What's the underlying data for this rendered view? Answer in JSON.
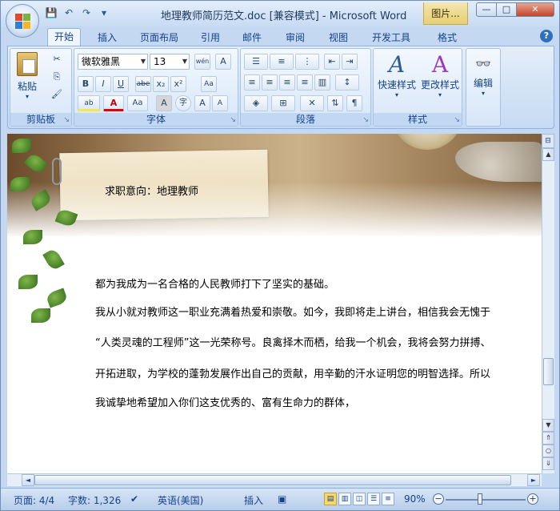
{
  "window": {
    "title": "地理教师简历范文.doc [兼容模式] - Microsoft Word",
    "context_tab": "图片...",
    "controls": {
      "minimize": "—",
      "maximize": "□",
      "close": "✕"
    }
  },
  "qat": {
    "save": "💾",
    "undo": "↶",
    "redo": "↷",
    "more": "▾"
  },
  "tabs": [
    {
      "label": "开始"
    },
    {
      "label": "插入"
    },
    {
      "label": "页面布局"
    },
    {
      "label": "引用"
    },
    {
      "label": "邮件"
    },
    {
      "label": "审阅"
    },
    {
      "label": "视图"
    },
    {
      "label": "开发工具"
    },
    {
      "label": "格式"
    }
  ],
  "help": "?",
  "ribbon": {
    "clipboard": {
      "label": "剪贴板",
      "paste": "粘贴",
      "cut": "✂",
      "copy": "⎘",
      "painter": "🖌"
    },
    "font": {
      "label": "字体",
      "name": "微软雅黑",
      "size": "13",
      "phonetic": "wén",
      "char_border": "A",
      "bold": "B",
      "italic": "I",
      "underline": "U",
      "strike": "abe",
      "subscript": "x₂",
      "superscript": "x²",
      "clear": "Aa",
      "highlight": "ab",
      "color": "A",
      "change_case": "Aa",
      "char_shade": "A",
      "enclose": "字",
      "grow": "A",
      "shrink": "A"
    },
    "paragraph": {
      "label": "段落"
    },
    "styles": {
      "label": "样式",
      "quick": "快速样式",
      "change": "更改样式"
    },
    "editing": {
      "label": "编辑"
    }
  },
  "document": {
    "heading": "求职意向：地理教师",
    "paragraphs": [
      "都为我成为一名合格的人民教师打下了坚实的基础。",
      "我从小就对教师这一职业充满着热爱和崇敬。如今，我即将走上讲台，相信我会无愧于",
      "“人类灵魂的工程师”这一光荣称号。良禽择木而栖，给我一个机会，我将会努力拼搏、",
      "开拓进取，为学校的蓬勃发展作出自己的贡献，用辛勤的汗水证明您的明智选择。所以",
      "我诚挚地希望加入你们这支优秀的、富有生命力的群体，"
    ]
  },
  "statusbar": {
    "page": "页面: 4/4",
    "words": "字数: 1,326",
    "language": "英语(美国)",
    "mode": "插入",
    "zoom": "90%",
    "zoom_level": 0.9
  }
}
